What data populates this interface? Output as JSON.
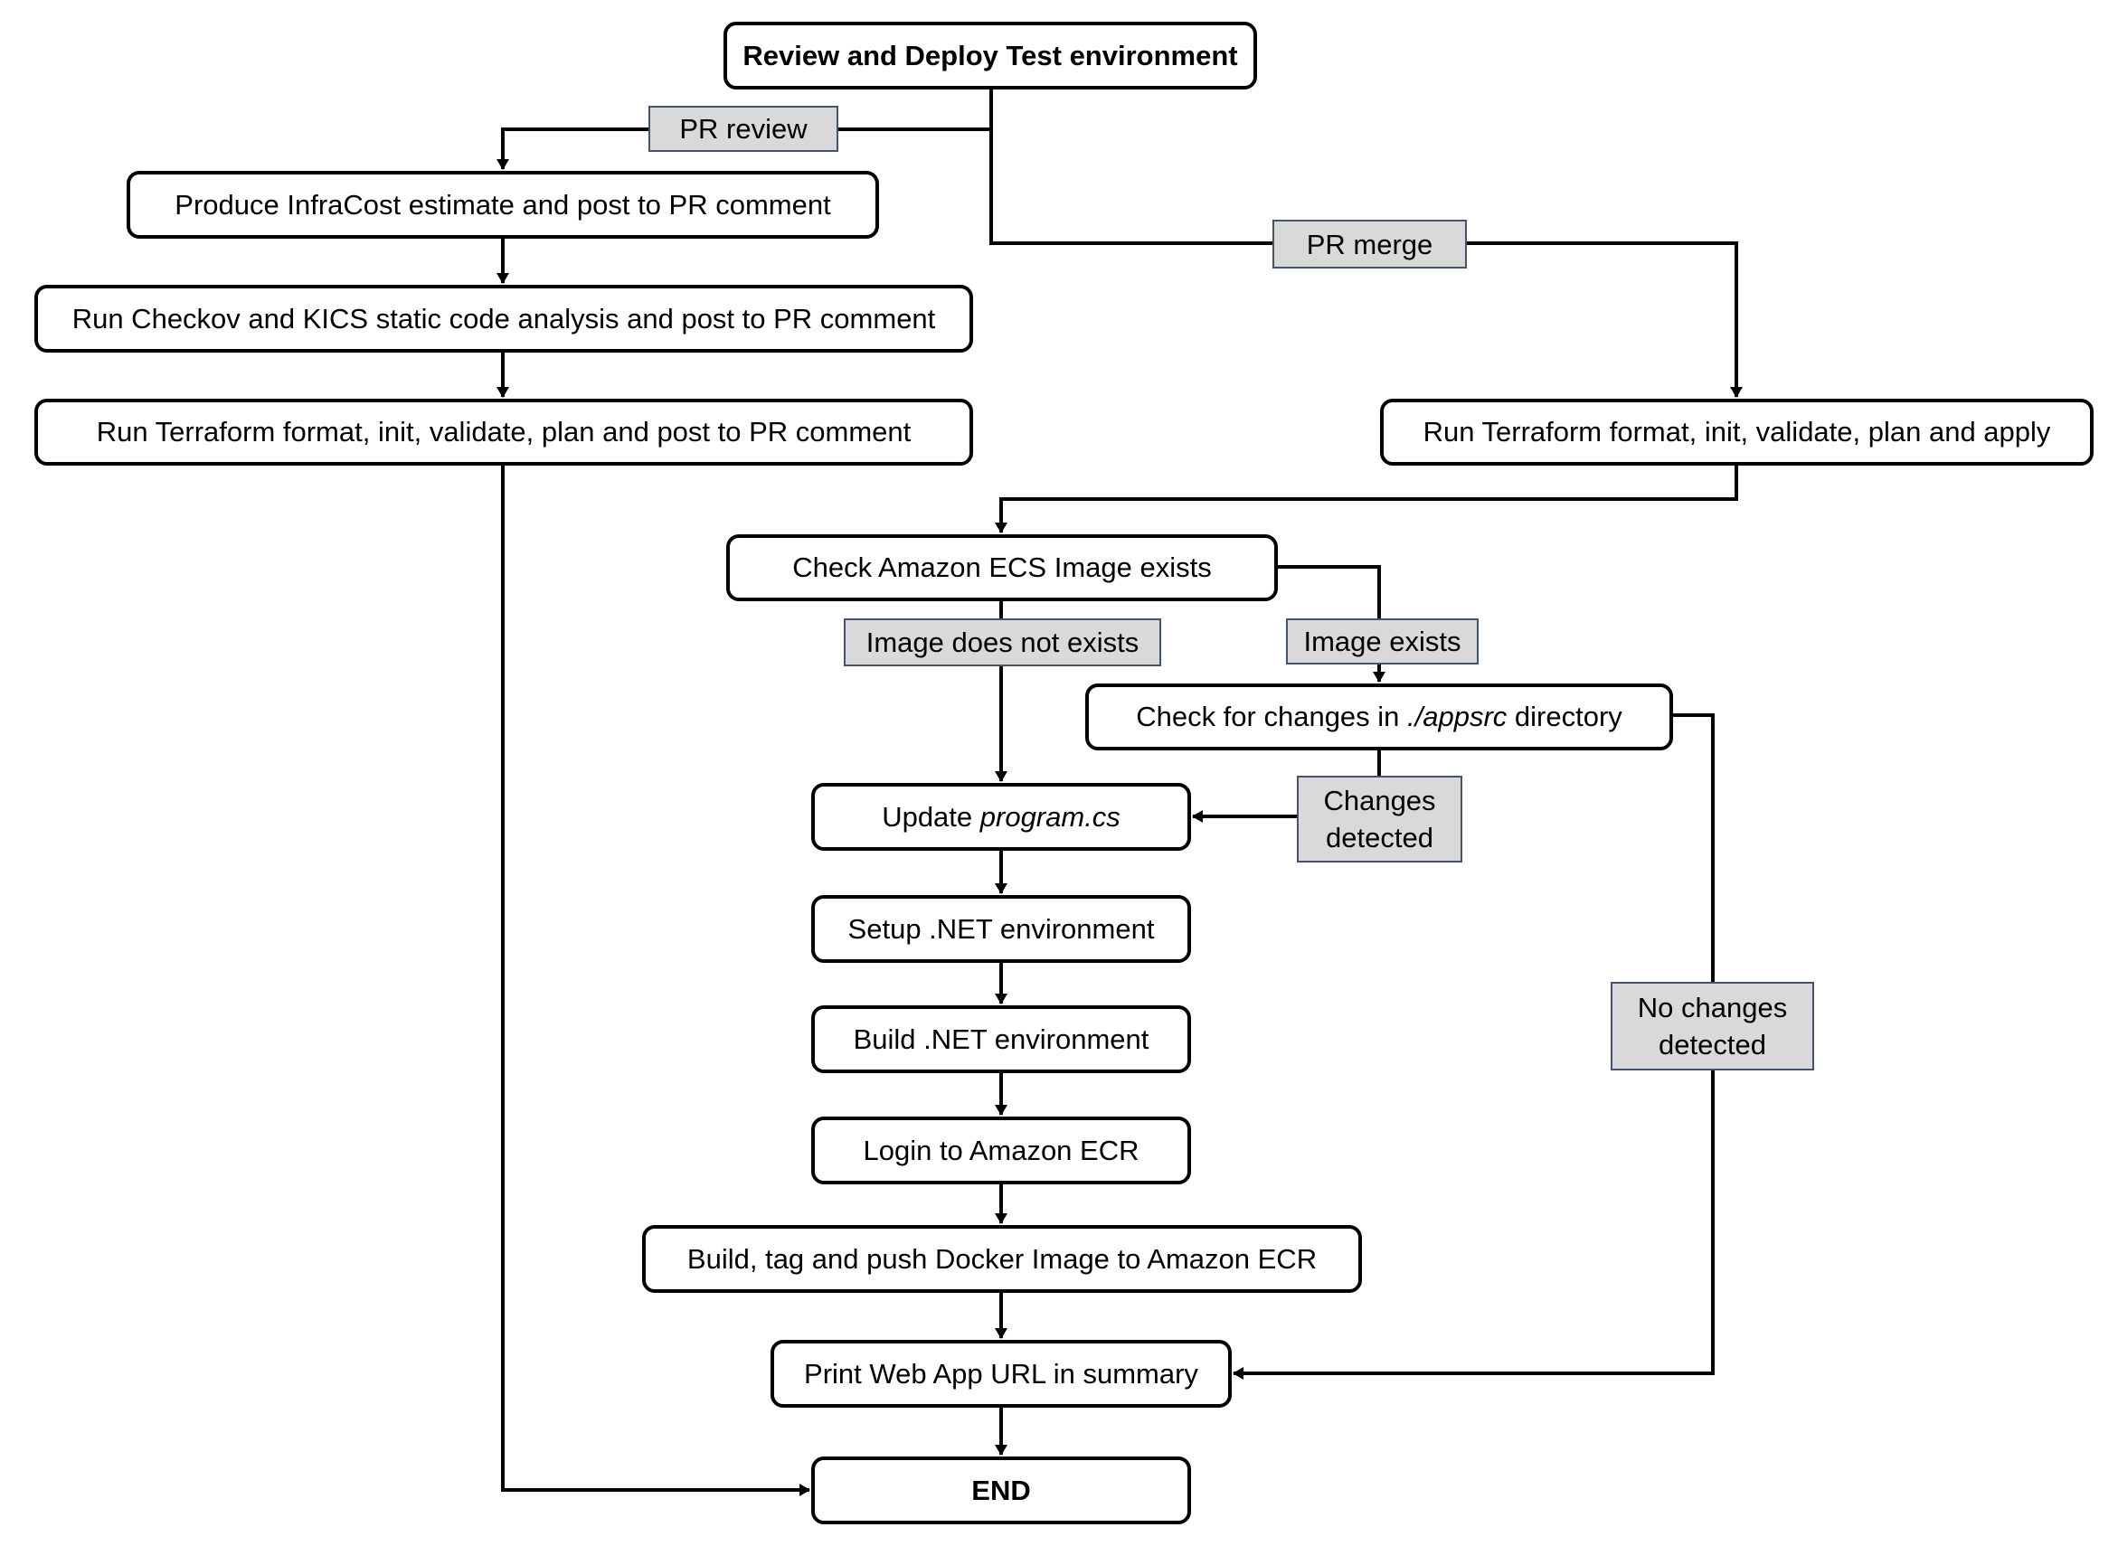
{
  "diagram": {
    "title": "Review and Deploy Test environment",
    "nodes": {
      "start": "Review and Deploy Test environment",
      "infracost": "Produce InfraCost estimate and post to PR comment",
      "checkov": "Run Checkov and KICS static code analysis and post to PR comment",
      "terraform_pr": "Run Terraform format, init, validate, plan and post to PR comment",
      "terraform_apply": "Run Terraform format, init, validate, plan and apply",
      "check_ecs": "Check Amazon ECS Image exists",
      "check_changes_prefix": "Check for changes in ",
      "check_changes_path": "./appsrc",
      "check_changes_suffix": " directory",
      "update_prefix": "Update ",
      "update_file": "program.cs",
      "setup_net": "Setup .NET environment",
      "build_net": "Build .NET environment",
      "login_ecr": "Login to Amazon ECR",
      "build_push": "Build, tag and push Docker Image to Amazon ECR",
      "print_url": "Print Web App URL in summary",
      "end": "END"
    },
    "labels": {
      "pr_review": "PR review",
      "pr_merge": "PR merge",
      "image_not_exists": "Image does not exists",
      "image_exists": "Image exists",
      "changes_detected_1": "Changes",
      "changes_detected_2": "detected",
      "no_changes_1": "No changes",
      "no_changes_2": "detected"
    },
    "edges": [
      {
        "from": "start",
        "to": "infracost",
        "label": "PR review"
      },
      {
        "from": "start",
        "to": "terraform_apply",
        "label": "PR merge"
      },
      {
        "from": "infracost",
        "to": "checkov"
      },
      {
        "from": "checkov",
        "to": "terraform_pr"
      },
      {
        "from": "terraform_pr",
        "to": "end"
      },
      {
        "from": "terraform_apply",
        "to": "check_ecs"
      },
      {
        "from": "check_ecs",
        "to": "update_program",
        "label": "Image does not exists"
      },
      {
        "from": "check_ecs",
        "to": "check_changes",
        "label": "Image exists"
      },
      {
        "from": "check_changes",
        "to": "update_program",
        "label": "Changes detected"
      },
      {
        "from": "check_changes",
        "to": "print_url",
        "label": "No changes detected"
      },
      {
        "from": "update_program",
        "to": "setup_net"
      },
      {
        "from": "setup_net",
        "to": "build_net"
      },
      {
        "from": "build_net",
        "to": "login_ecr"
      },
      {
        "from": "login_ecr",
        "to": "build_push"
      },
      {
        "from": "build_push",
        "to": "print_url"
      },
      {
        "from": "print_url",
        "to": "end"
      }
    ],
    "colors": {
      "line": "#000000",
      "label_fill": "#d9d9d9",
      "label_border": "#44546a",
      "node_fill": "#ffffff"
    }
  }
}
